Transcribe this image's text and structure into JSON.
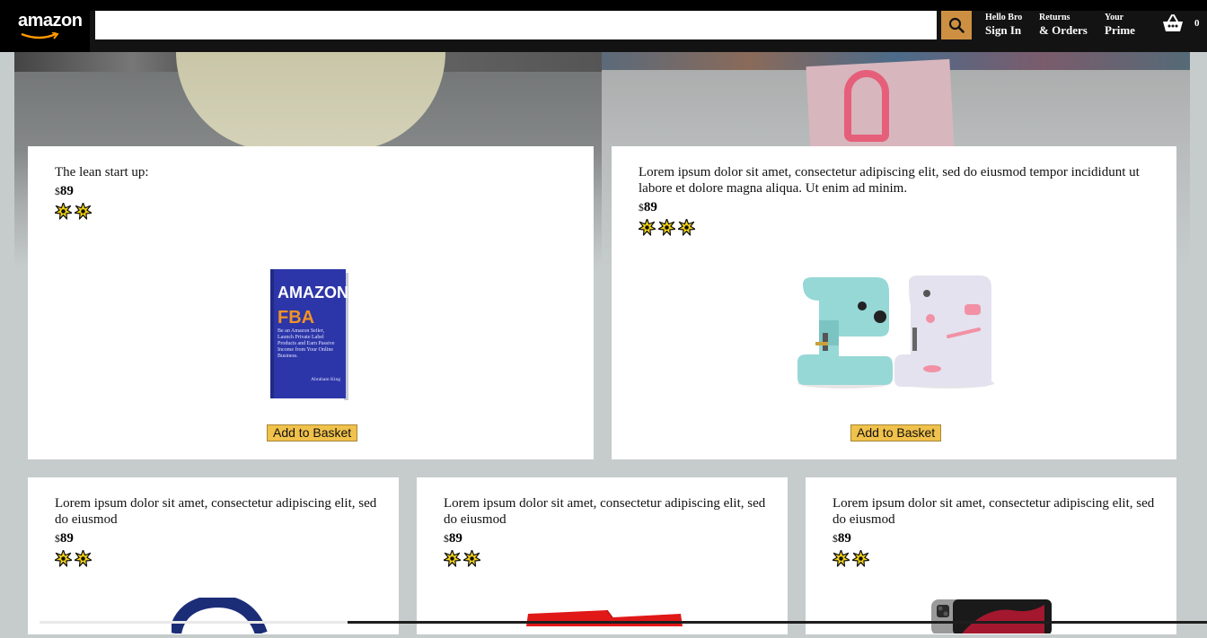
{
  "header": {
    "logo_text": "amazon",
    "search_placeholder": "",
    "options": [
      {
        "line1": "Hello Bro",
        "line2": "Sign In"
      },
      {
        "line1": "Returns",
        "line2": "& Orders"
      },
      {
        "line1": "Your",
        "line2": "Prime"
      }
    ],
    "basket_count": "0"
  },
  "colors": {
    "header_bg": "#131313",
    "search_button": "#cd9042",
    "add_button": "#f0c14b",
    "page_bg": "#c6cbcb"
  },
  "products": [
    {
      "title": "The lean start up:",
      "currency": "$",
      "price": "89",
      "rating": 2,
      "button": "Add to Basket",
      "image": "amazon-fba-book"
    },
    {
      "title": "Lorem ipsum dolor sit amet, consectetur adipiscing elit, sed do eiusmod tempor incididunt ut labore et dolore magna aliqua. Ut enim ad minim.",
      "currency": "$",
      "price": "89",
      "rating": 3,
      "button": "Add to Basket",
      "image": "sewing-machines"
    },
    {
      "title": "Lorem ipsum dolor sit amet, consectetur adipiscing elit, sed do eiusmod",
      "currency": "$",
      "price": "89",
      "rating": 2,
      "image": "smartwatch-band"
    },
    {
      "title": "Lorem ipsum dolor sit amet, consectetur adipiscing elit, sed do eiusmod",
      "currency": "$",
      "price": "89",
      "rating": 2,
      "image": "red-box"
    },
    {
      "title": "Lorem ipsum dolor sit amet, consectetur adipiscing elit, sed do eiusmod",
      "currency": "$",
      "price": "89",
      "rating": 2,
      "image": "tablet"
    }
  ],
  "book": {
    "line1": "AMAZON",
    "line2": "FBA",
    "blurb": "Be an Amazon Seller, Launch Private Label Products and Earn Passive Income from Your Online Business.",
    "author": "Abraham King"
  }
}
